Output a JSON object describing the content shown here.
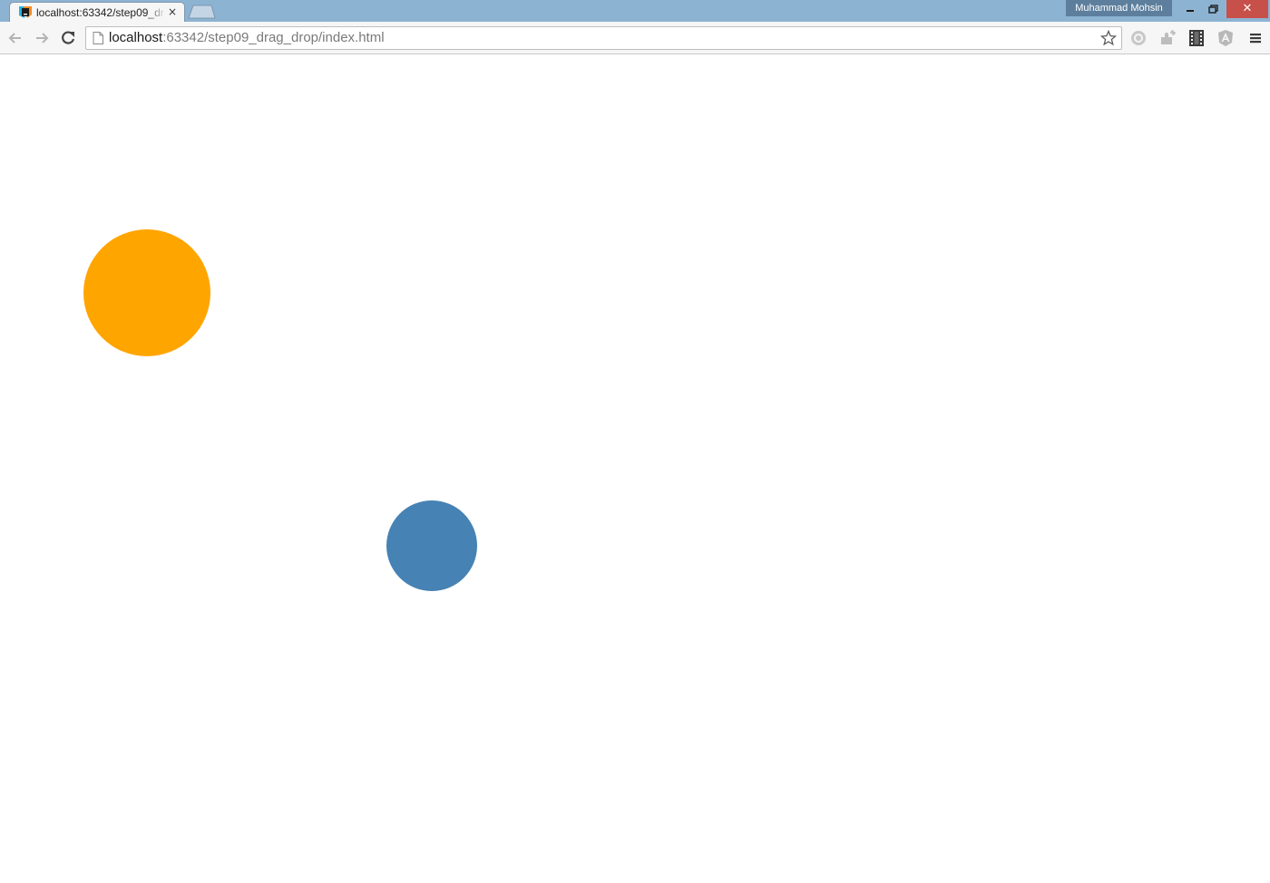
{
  "browser": {
    "tab": {
      "title": "localhost:63342/step09_drag_drop/index.html",
      "favicon": "webstorm-icon",
      "close_glyph": "×"
    },
    "new_tab": "new-tab-button",
    "profile_name": "Muhammad Mohsin",
    "window_controls": {
      "minimize": "minimize-icon",
      "restore": "restore-icon",
      "close": "close-icon",
      "close_glyph": "✕"
    },
    "nav": {
      "back": "back-arrow-icon",
      "forward": "forward-arrow-icon",
      "reload": "reload-icon"
    },
    "address_bar": {
      "host": "localhost",
      "rest": ":63342/step09_drag_drop/index.html"
    },
    "extensions": [
      "record-icon",
      "puzzle-extension-icon",
      "film-strip-icon",
      "angular-shield-icon",
      "menu-icon"
    ]
  },
  "page": {
    "circles": [
      {
        "name": "orange-circle",
        "color": "#ffa500"
      },
      {
        "name": "blue-circle",
        "color": "#4682b4"
      }
    ]
  }
}
